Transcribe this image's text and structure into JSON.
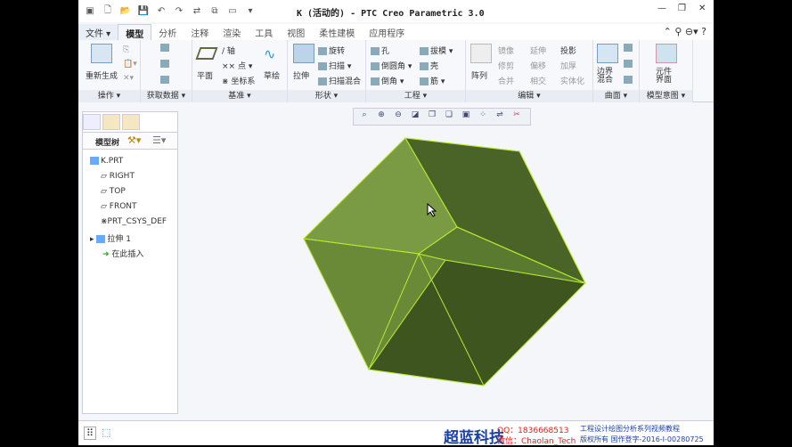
{
  "title": "K (活动的) - PTC Creo Parametric 3.0",
  "tabs": [
    "文件 ▾",
    "模型",
    "分析",
    "注释",
    "渲染",
    "工具",
    "视图",
    "柔性建模",
    "应用程序"
  ],
  "groups": {
    "ops": "操作 ▾",
    "getdata": "获取数据 ▾",
    "datum": "基准 ▾",
    "shapes": "形状 ▾",
    "eng": "工程 ▾",
    "edit": "编辑 ▾",
    "surface": "曲面 ▾",
    "intent": "模型意图 ▾"
  },
  "ribbon": {
    "regen": "重新生成",
    "plane": "平面",
    "axis": "轴",
    "point": "点 ▾",
    "csys": "坐标系",
    "sketch": "草绘",
    "extrude": "拉伸",
    "revolve": "旋转",
    "sweep": "扫描 ▾",
    "swept_blend": "扫描混合",
    "hole": "孔",
    "round": "倒圆角 ▾",
    "chamfer": "倒角 ▾",
    "draft": "拔模 ▾",
    "shell": "壳",
    "rib": "筋 ▾",
    "pattern": "阵列",
    "mirror": "镜像",
    "extend": "延伸",
    "project": "投影",
    "trim": "修剪",
    "offset": "偏移",
    "thicken": "加厚",
    "merge": "合并",
    "intersect": "相交",
    "solidify": "实体化",
    "boundary": "边界混合",
    "component": "元件界面"
  },
  "tree": {
    "header": "模型树",
    "items": [
      "K.PRT",
      "RIGHT",
      "TOP",
      "FRONT",
      "PRT_CSYS_DEF",
      "拉伸 1",
      "在此插入"
    ]
  },
  "watermark": {
    "brand": "超蓝科技",
    "qq": "QQ：1836668513",
    "wechat": "微信：Chaolan_Tech",
    "series": "工程设计绘图分析系列视频教程",
    "copyright": "版权所有  国作登字-2016-I-00280725"
  }
}
